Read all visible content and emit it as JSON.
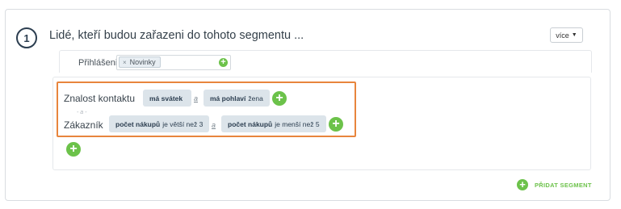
{
  "segment": {
    "step_number": "1",
    "title": "Lidé, kteří budou zařazeni do tohoto segmentu ...",
    "more_button": "více",
    "login": {
      "label": "Přihlášeni k",
      "tags": [
        "Novinky"
      ]
    },
    "conditions": {
      "or_separator": "- a -",
      "rows": [
        {
          "label": "Znalost kontaktu",
          "chips": [
            {
              "bold": "má svátek",
              "rest": ""
            },
            {
              "bold": "má pohlaví",
              "rest": "žena"
            }
          ],
          "connector": "a"
        },
        {
          "label": "Zákazník",
          "chips": [
            {
              "bold": "počet nákupů",
              "rest": "je větší než 3"
            },
            {
              "bold": "počet nákupů",
              "rest": "je menší než 5"
            }
          ],
          "connector": "a"
        }
      ]
    },
    "add_segment_label": "PŘIDAT SEGMENT"
  },
  "colors": {
    "accent_green": "#6cc24a",
    "highlight_orange": "#e8853d",
    "chip_bg": "#dce4ea"
  }
}
